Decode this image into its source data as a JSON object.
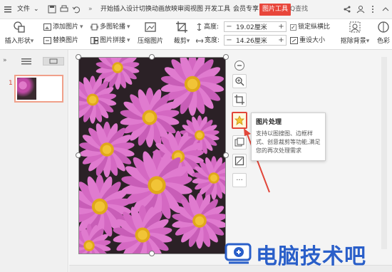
{
  "menubar": {
    "file_label": "文件",
    "tabs": [
      "开始",
      "插入",
      "设计",
      "切换",
      "动画",
      "放映",
      "审阅",
      "视图",
      "开发工具",
      "会员专享"
    ],
    "active_tab": "图片工具",
    "search_label": "Q查找",
    "more_label": "»"
  },
  "ribbon": {
    "insert_shape": "插入形状",
    "add_picture": "添加图片",
    "replace_picture": "替换图片",
    "multi_carousel": "多图轮播",
    "picture_collage": "图片拼接",
    "compress_picture": "压缩图片",
    "crop": "裁剪",
    "height_label": "高度:",
    "height_value": "19.02厘米",
    "width_label": "宽度:",
    "width_value": "14.26厘米",
    "lock_ratio": "锁定纵横比",
    "reset_size": "重设大小",
    "remove_bg": "抠除背景",
    "color": "色彩"
  },
  "leftpanel": {
    "slide_number": "1"
  },
  "float_toolbar": {
    "tools": [
      "minus-icon",
      "zoom-icon",
      "crop-icon",
      "picture-process-icon",
      "picture-multi-icon",
      "frame-icon",
      "more-icon"
    ],
    "more_label": "···"
  },
  "tooltip": {
    "title": "图片处理",
    "body": "支持以图搜图、边框样式、创意裁剪等功能,满足您的再次处理需求"
  },
  "watermark": {
    "text": "电脑技术吧"
  },
  "colors": {
    "accent": "#e8463b",
    "highlight_border": "#e1463a",
    "watermark": "#2a5fc9"
  }
}
